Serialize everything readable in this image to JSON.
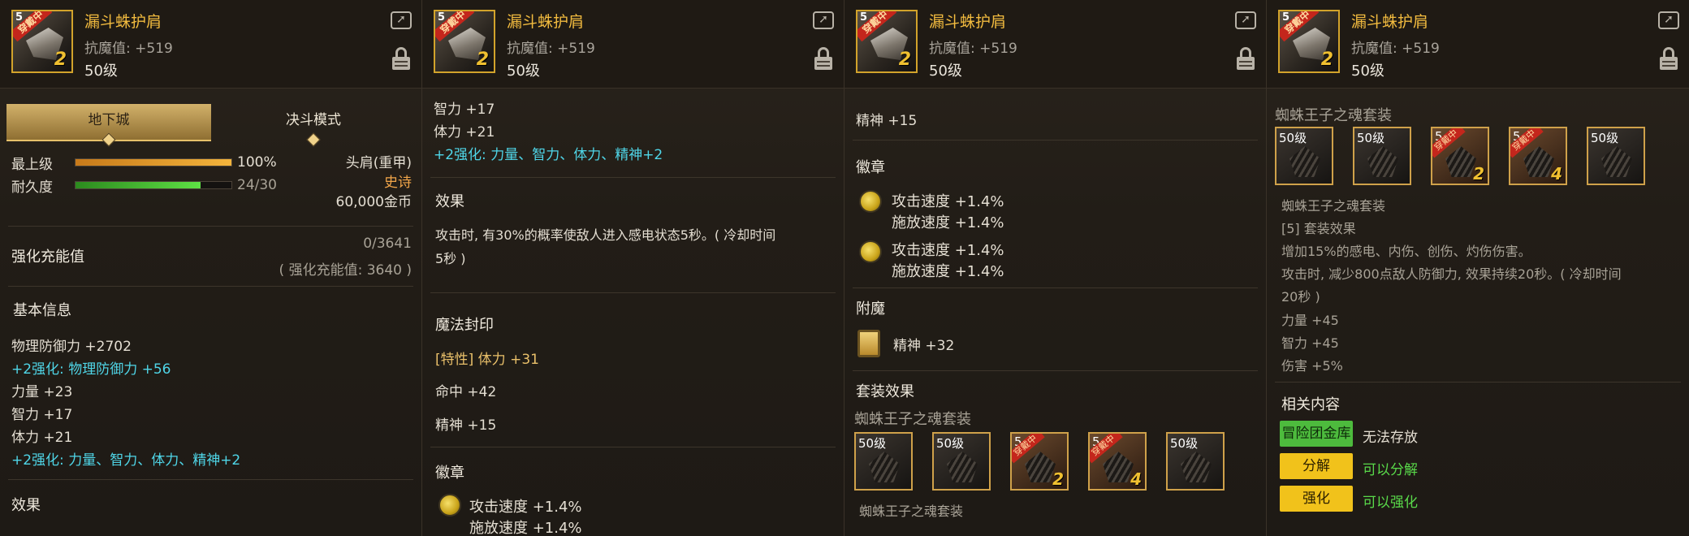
{
  "item": {
    "name": "漏斗蛛护肩",
    "magic_resist": "抗魔值: +519",
    "level": "50级",
    "icon_level": "5",
    "icon_badge": "穿戴中",
    "icon_number": "2"
  },
  "panel1": {
    "tab_dungeon": "地下城",
    "tab_pvp": "决斗模式",
    "max_level_label": "最上级",
    "max_level_value": "100%",
    "max_level_progress": 1.0,
    "durability_label": "耐久度",
    "durability_value": "24/30",
    "durability_progress": 0.8,
    "slot": "头肩(重甲)",
    "rarity": "史诗",
    "price": "60,000金币",
    "charge_label": "强化充能值",
    "charge_value": "0/3641",
    "charge_sub": "( 强化充能值: 3640 )",
    "basic_info_title": "基本信息",
    "stats": [
      {
        "text": "物理防御力 +2702",
        "color": "white"
      },
      {
        "text": "+2强化: 物理防御力 +56",
        "color": "cyan"
      },
      {
        "text": "力量 +23",
        "color": "white"
      },
      {
        "text": "智力 +17",
        "color": "white"
      },
      {
        "text": "体力 +21",
        "color": "white"
      },
      {
        "text": "+2强化: 力量、智力、体力、精神+2",
        "color": "cyan"
      }
    ],
    "effect_title": "效果"
  },
  "panel2": {
    "stats": [
      {
        "text": "智力 +17",
        "color": "white"
      },
      {
        "text": "体力 +21",
        "color": "white"
      },
      {
        "text": "+2强化: 力量、智力、体力、精神+2",
        "color": "cyan"
      }
    ],
    "effect_title": "效果",
    "effect_text_1": "攻击时, 有30%的概率使敌人进入感电状态5秒。( 冷却时间",
    "effect_text_2": "5秒 )",
    "seal_title": "魔法封印",
    "seal_trait_prefix": "[特性]",
    "seal_trait": "体力 +31",
    "seal_line2": "命中 +42",
    "seal_line3": "精神 +15",
    "emblem_title": "徽章",
    "emblem_line1": "攻击速度 +1.4%",
    "emblem_line2": "施放速度 +1.4%"
  },
  "panel3": {
    "spirit": "精神 +15",
    "emblem_title": "徽章",
    "emblems": [
      {
        "line1": "攻击速度 +1.4%",
        "line2": "施放速度 +1.4%"
      },
      {
        "line1": "攻击速度 +1.4%",
        "line2": "施放速度 +1.4%"
      }
    ],
    "enchant_title": "附魔",
    "enchant_value": "精神 +32",
    "set_title": "套装效果",
    "set_name": "蜘蛛王子之魂套装",
    "set_items": [
      {
        "level": "50级",
        "worn": false,
        "number": ""
      },
      {
        "level": "50级",
        "worn": false,
        "number": ""
      },
      {
        "level": "5",
        "worn": true,
        "number": "2",
        "badge": "穿戴中"
      },
      {
        "level": "5",
        "worn": true,
        "number": "4",
        "badge": "穿戴中"
      },
      {
        "level": "50级",
        "worn": false,
        "number": ""
      }
    ],
    "set_name_bottom": "蜘蛛王子之魂套装"
  },
  "panel4": {
    "set_name": "蜘蛛王子之魂套装",
    "set_items": [
      {
        "level": "50级",
        "worn": false,
        "number": ""
      },
      {
        "level": "50级",
        "worn": false,
        "number": ""
      },
      {
        "level": "5",
        "worn": true,
        "number": "2",
        "badge": "穿戴中"
      },
      {
        "level": "5",
        "worn": true,
        "number": "4",
        "badge": "穿戴中"
      },
      {
        "level": "50级",
        "worn": false,
        "number": ""
      }
    ],
    "set_name2": "蜘蛛王子之魂套装",
    "set_effect_header": "[5] 套装效果",
    "set_effect_1": "增加15%的感电、内伤、创伤、灼伤伤害。",
    "set_effect_2": "攻击时, 减少800点敌人防御力, 效果持续20秒。( 冷却时间",
    "set_effect_3": "20秒 )",
    "set_stat_1": "力量 +45",
    "set_stat_2": "智力 +45",
    "set_stat_3": "伤害 +5%",
    "related_title": "相关内容",
    "btn_vault": "冒险团金库",
    "vault_status": "无法存放",
    "btn_disassemble": "分解",
    "disassemble_status": "可以分解",
    "btn_enhance": "强化",
    "enhance_status": "可以强化"
  },
  "colors": {
    "accent_gold": "#f2bb3f",
    "cyan_bonus": "#4fd6e8",
    "rarity_orange": "#f2a64a",
    "ok_green": "#59d94a"
  }
}
